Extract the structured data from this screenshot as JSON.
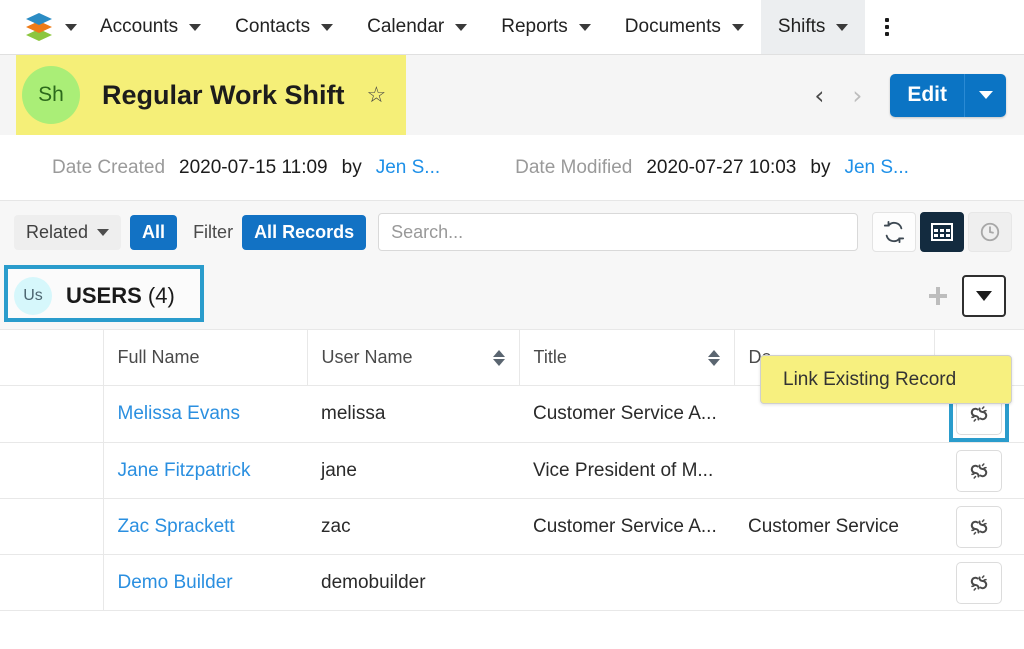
{
  "navbar": {
    "logo_name": "sugar-logo",
    "logo_colors": [
      "#2b8cc4",
      "#ee7b18",
      "#8cc63e"
    ],
    "logo_caret_label": "▾",
    "items": [
      {
        "label": "Accounts",
        "active": false
      },
      {
        "label": "Contacts",
        "active": false
      },
      {
        "label": "Calendar",
        "active": false
      },
      {
        "label": "Reports",
        "active": false
      },
      {
        "label": "Documents",
        "active": false
      },
      {
        "label": "Shifts",
        "active": true
      }
    ],
    "kebab_label": "More"
  },
  "record_header": {
    "avatar_initials": "Sh",
    "title": "Regular Work Shift",
    "favorite_icon": "☆",
    "prev_label": "‹",
    "next_label": "›",
    "edit_label": "Edit",
    "highlight_color": "#f5ef78"
  },
  "meta": {
    "created_label": "Date Created",
    "created_value": "2020-07-15 11:09",
    "created_by_word": "by",
    "created_by_user": "Jen S...",
    "modified_label": "Date Modified",
    "modified_value": "2020-07-27 10:03",
    "modified_by_word": "by",
    "modified_by_user": "Jen S..."
  },
  "filter_bar": {
    "related_label": "Related",
    "all_label": "All",
    "filter_label": "Filter",
    "all_records_label": "All Records",
    "search_placeholder": "Search...",
    "search_value": "",
    "refresh_icon": "refresh-icon",
    "grid_icon": "grid-view-icon",
    "clock_icon": "clock-icon"
  },
  "panel": {
    "badge": "Us",
    "title": "USERS",
    "count": "(4)",
    "add_icon": "plus-icon",
    "dropdown_icon": "chevron-down-icon",
    "highlight_color": "#2a9ccc"
  },
  "tooltip": {
    "text": "Link Existing Record"
  },
  "table": {
    "columns": [
      {
        "label": "",
        "sortable": false
      },
      {
        "label": "Full Name",
        "sortable": false
      },
      {
        "label": "User Name",
        "sortable": true
      },
      {
        "label": "Title",
        "sortable": true
      },
      {
        "label": "De",
        "sortable": false
      },
      {
        "label": "",
        "sortable": false
      }
    ],
    "rows": [
      {
        "full_name": "Melissa Evans",
        "user_name": "melissa",
        "title": "Customer Service A...",
        "department": "",
        "action_icon": "unlink-icon",
        "action_highlighted": true
      },
      {
        "full_name": "Jane Fitzpatrick",
        "user_name": "jane",
        "title": "Vice President of M...",
        "department": "",
        "action_icon": "unlink-icon",
        "action_highlighted": false
      },
      {
        "full_name": "Zac Sprackett",
        "user_name": "zac",
        "title": "Customer Service A...",
        "department": "Customer Service",
        "action_icon": "unlink-icon",
        "action_highlighted": false
      },
      {
        "full_name": "Demo Builder",
        "user_name": "demobuilder",
        "title": "",
        "department": "",
        "action_icon": "unlink-icon",
        "action_highlighted": false
      }
    ]
  }
}
